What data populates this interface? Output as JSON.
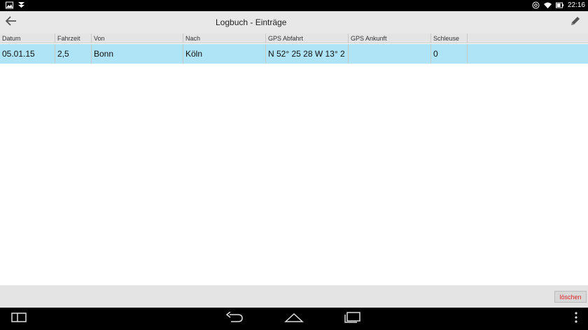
{
  "status_bar": {
    "time": "22:16",
    "icons": [
      "image-icon",
      "download-icon",
      "at-icon",
      "wifi-icon",
      "battery-icon"
    ]
  },
  "action_bar": {
    "title": "Logbuch - Einträge",
    "back_icon": "back-arrow-icon",
    "edit_icon": "pencil-icon"
  },
  "table": {
    "columns": [
      "Datum",
      "Fahrzeit",
      "Von",
      "Nach",
      "GPS Abfahrt",
      "GPS Ankunft",
      "Schleuse",
      ""
    ],
    "rows": [
      [
        "05.01.15",
        "2,5",
        "Bonn",
        "Köln",
        "N 52° 25  28    W 13° 2",
        "",
        "0",
        ""
      ]
    ]
  },
  "bottom_bar": {
    "delete_label": "löschen"
  },
  "nav_bar": {
    "icons": [
      "recent-apps-icon",
      "back-icon",
      "home-icon",
      "overview-icon",
      "menu-icon"
    ]
  },
  "colors": {
    "selected_row": "#aee4f5",
    "delete_text": "#e02020",
    "action_bar_bg": "#e8e8e8"
  }
}
